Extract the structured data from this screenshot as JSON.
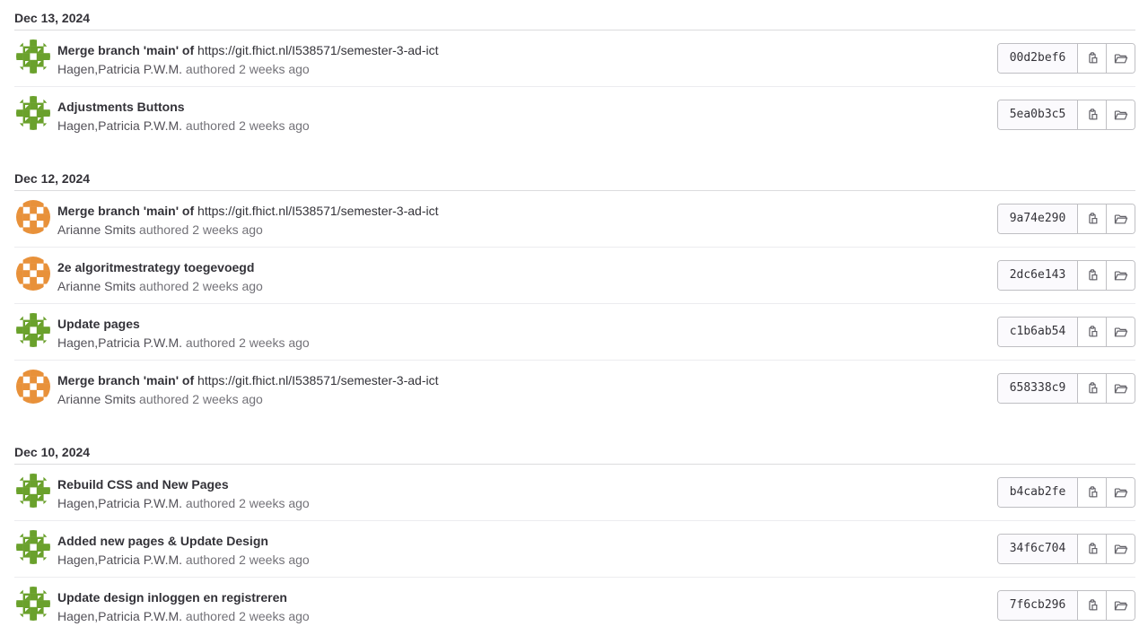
{
  "colors": {
    "avatar_green": "#6aa12c",
    "avatar_orange": "#e8913a",
    "border": "#dcdcde",
    "text": "#333238",
    "muted": "#737278"
  },
  "groups": [
    {
      "date": "Dec 13, 2024",
      "commits": [
        {
          "title": "Merge branch 'main' of",
          "link": "https://git.fhict.nl/I538571/semester-3-ad-ict",
          "author": "Hagen,Patricia P.W.M.",
          "verb": "authored",
          "time": "2 weeks ago",
          "sha": "00d2bef6",
          "avatar": "green-identicon"
        },
        {
          "title": "Adjustments Buttons",
          "link": "",
          "author": "Hagen,Patricia P.W.M.",
          "verb": "authored",
          "time": "2 weeks ago",
          "sha": "5ea0b3c5",
          "avatar": "green-identicon"
        }
      ]
    },
    {
      "date": "Dec 12, 2024",
      "commits": [
        {
          "title": "Merge branch 'main' of",
          "link": "https://git.fhict.nl/I538571/semester-3-ad-ict",
          "author": "Arianne Smits",
          "verb": "authored",
          "time": "2 weeks ago",
          "sha": "9a74e290",
          "avatar": "orange-identicon"
        },
        {
          "title": "2e algoritmestrategy toegevoegd",
          "link": "",
          "author": "Arianne Smits",
          "verb": "authored",
          "time": "2 weeks ago",
          "sha": "2dc6e143",
          "avatar": "orange-identicon"
        },
        {
          "title": "Update pages",
          "link": "",
          "author": "Hagen,Patricia P.W.M.",
          "verb": "authored",
          "time": "2 weeks ago",
          "sha": "c1b6ab54",
          "avatar": "green-identicon"
        },
        {
          "title": "Merge branch 'main' of",
          "link": "https://git.fhict.nl/I538571/semester-3-ad-ict",
          "author": "Arianne Smits",
          "verb": "authored",
          "time": "2 weeks ago",
          "sha": "658338c9",
          "avatar": "orange-identicon"
        }
      ]
    },
    {
      "date": "Dec 10, 2024",
      "commits": [
        {
          "title": "Rebuild CSS and New Pages",
          "link": "",
          "author": "Hagen,Patricia P.W.M.",
          "verb": "authored",
          "time": "2 weeks ago",
          "sha": "b4cab2fe",
          "avatar": "green-identicon"
        },
        {
          "title": "Added new pages & Update Design",
          "link": "",
          "author": "Hagen,Patricia P.W.M.",
          "verb": "authored",
          "time": "2 weeks ago",
          "sha": "34f6c704",
          "avatar": "green-identicon"
        },
        {
          "title": "Update design inloggen en registreren",
          "link": "",
          "author": "Hagen,Patricia P.W.M.",
          "verb": "authored",
          "time": "2 weeks ago",
          "sha": "7f6cb296",
          "avatar": "green-identicon"
        }
      ]
    }
  ],
  "icons": {
    "copy": "copy-icon",
    "browse": "folder-open-icon"
  }
}
